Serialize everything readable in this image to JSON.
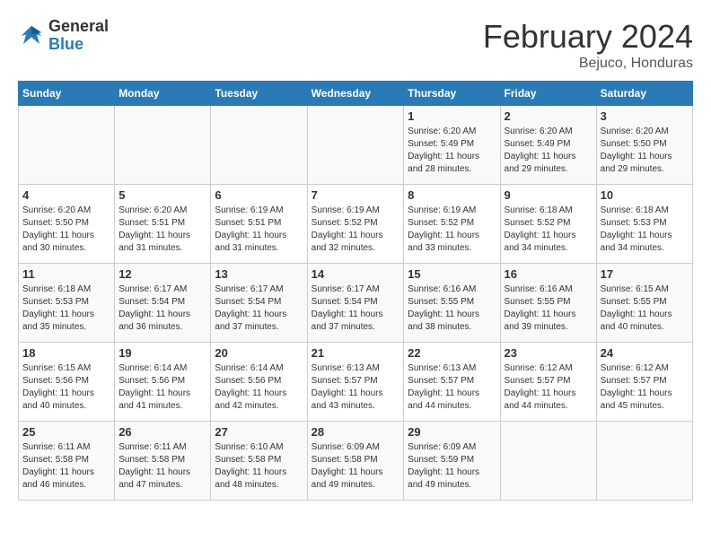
{
  "header": {
    "logo_general": "General",
    "logo_blue": "Blue",
    "month_title": "February 2024",
    "subtitle": "Bejuco, Honduras"
  },
  "weekdays": [
    "Sunday",
    "Monday",
    "Tuesday",
    "Wednesday",
    "Thursday",
    "Friday",
    "Saturday"
  ],
  "weeks": [
    [
      {
        "day": "",
        "info": ""
      },
      {
        "day": "",
        "info": ""
      },
      {
        "day": "",
        "info": ""
      },
      {
        "day": "",
        "info": ""
      },
      {
        "day": "1",
        "info": "Sunrise: 6:20 AM\nSunset: 5:49 PM\nDaylight: 11 hours\nand 28 minutes."
      },
      {
        "day": "2",
        "info": "Sunrise: 6:20 AM\nSunset: 5:49 PM\nDaylight: 11 hours\nand 29 minutes."
      },
      {
        "day": "3",
        "info": "Sunrise: 6:20 AM\nSunset: 5:50 PM\nDaylight: 11 hours\nand 29 minutes."
      }
    ],
    [
      {
        "day": "4",
        "info": "Sunrise: 6:20 AM\nSunset: 5:50 PM\nDaylight: 11 hours\nand 30 minutes."
      },
      {
        "day": "5",
        "info": "Sunrise: 6:20 AM\nSunset: 5:51 PM\nDaylight: 11 hours\nand 31 minutes."
      },
      {
        "day": "6",
        "info": "Sunrise: 6:19 AM\nSunset: 5:51 PM\nDaylight: 11 hours\nand 31 minutes."
      },
      {
        "day": "7",
        "info": "Sunrise: 6:19 AM\nSunset: 5:52 PM\nDaylight: 11 hours\nand 32 minutes."
      },
      {
        "day": "8",
        "info": "Sunrise: 6:19 AM\nSunset: 5:52 PM\nDaylight: 11 hours\nand 33 minutes."
      },
      {
        "day": "9",
        "info": "Sunrise: 6:18 AM\nSunset: 5:52 PM\nDaylight: 11 hours\nand 34 minutes."
      },
      {
        "day": "10",
        "info": "Sunrise: 6:18 AM\nSunset: 5:53 PM\nDaylight: 11 hours\nand 34 minutes."
      }
    ],
    [
      {
        "day": "11",
        "info": "Sunrise: 6:18 AM\nSunset: 5:53 PM\nDaylight: 11 hours\nand 35 minutes."
      },
      {
        "day": "12",
        "info": "Sunrise: 6:17 AM\nSunset: 5:54 PM\nDaylight: 11 hours\nand 36 minutes."
      },
      {
        "day": "13",
        "info": "Sunrise: 6:17 AM\nSunset: 5:54 PM\nDaylight: 11 hours\nand 37 minutes."
      },
      {
        "day": "14",
        "info": "Sunrise: 6:17 AM\nSunset: 5:54 PM\nDaylight: 11 hours\nand 37 minutes."
      },
      {
        "day": "15",
        "info": "Sunrise: 6:16 AM\nSunset: 5:55 PM\nDaylight: 11 hours\nand 38 minutes."
      },
      {
        "day": "16",
        "info": "Sunrise: 6:16 AM\nSunset: 5:55 PM\nDaylight: 11 hours\nand 39 minutes."
      },
      {
        "day": "17",
        "info": "Sunrise: 6:15 AM\nSunset: 5:55 PM\nDaylight: 11 hours\nand 40 minutes."
      }
    ],
    [
      {
        "day": "18",
        "info": "Sunrise: 6:15 AM\nSunset: 5:56 PM\nDaylight: 11 hours\nand 40 minutes."
      },
      {
        "day": "19",
        "info": "Sunrise: 6:14 AM\nSunset: 5:56 PM\nDaylight: 11 hours\nand 41 minutes."
      },
      {
        "day": "20",
        "info": "Sunrise: 6:14 AM\nSunset: 5:56 PM\nDaylight: 11 hours\nand 42 minutes."
      },
      {
        "day": "21",
        "info": "Sunrise: 6:13 AM\nSunset: 5:57 PM\nDaylight: 11 hours\nand 43 minutes."
      },
      {
        "day": "22",
        "info": "Sunrise: 6:13 AM\nSunset: 5:57 PM\nDaylight: 11 hours\nand 44 minutes."
      },
      {
        "day": "23",
        "info": "Sunrise: 6:12 AM\nSunset: 5:57 PM\nDaylight: 11 hours\nand 44 minutes."
      },
      {
        "day": "24",
        "info": "Sunrise: 6:12 AM\nSunset: 5:57 PM\nDaylight: 11 hours\nand 45 minutes."
      }
    ],
    [
      {
        "day": "25",
        "info": "Sunrise: 6:11 AM\nSunset: 5:58 PM\nDaylight: 11 hours\nand 46 minutes."
      },
      {
        "day": "26",
        "info": "Sunrise: 6:11 AM\nSunset: 5:58 PM\nDaylight: 11 hours\nand 47 minutes."
      },
      {
        "day": "27",
        "info": "Sunrise: 6:10 AM\nSunset: 5:58 PM\nDaylight: 11 hours\nand 48 minutes."
      },
      {
        "day": "28",
        "info": "Sunrise: 6:09 AM\nSunset: 5:58 PM\nDaylight: 11 hours\nand 49 minutes."
      },
      {
        "day": "29",
        "info": "Sunrise: 6:09 AM\nSunset: 5:59 PM\nDaylight: 11 hours\nand 49 minutes."
      },
      {
        "day": "",
        "info": ""
      },
      {
        "day": "",
        "info": ""
      }
    ]
  ]
}
